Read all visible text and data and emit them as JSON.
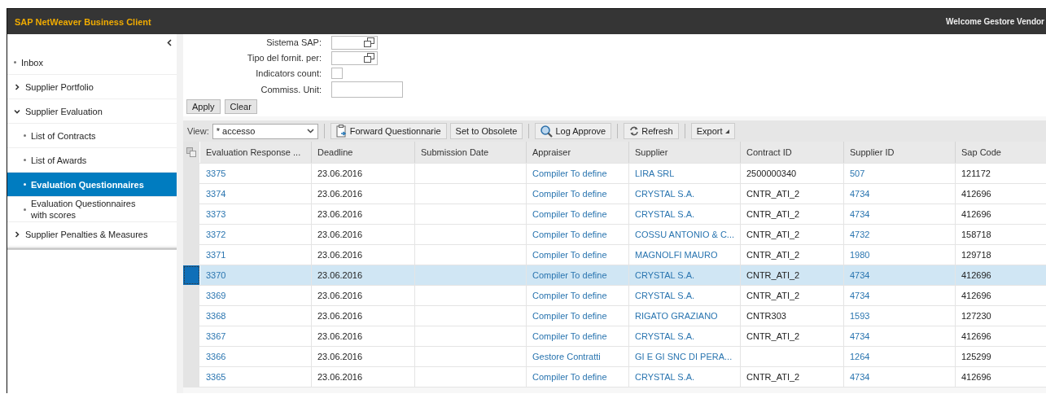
{
  "window": {
    "title": "SAP NetWeaver Business Client",
    "welcome": "Welcome Gestore Vendor"
  },
  "sidebar": {
    "items": [
      {
        "label": "Inbox",
        "kind": "leaf",
        "selected": false
      },
      {
        "label": "Supplier Portfolio",
        "kind": "group",
        "expanded": false
      },
      {
        "label": "Supplier Evaluation",
        "kind": "group",
        "expanded": true,
        "children": [
          {
            "label": "List of Contracts",
            "kind": "leaf",
            "selected": false
          },
          {
            "label": "List of Awards",
            "kind": "leaf",
            "selected": false
          },
          {
            "label": "Evaluation Questionnaires",
            "kind": "leaf",
            "selected": true
          },
          {
            "label": "Evaluation Questionnaires with scores",
            "kind": "leaf",
            "selected": false
          }
        ]
      },
      {
        "label": "Supplier Penalties & Measures",
        "kind": "group",
        "expanded": false
      }
    ]
  },
  "filter": {
    "fields": [
      {
        "label": "Sistema SAP:",
        "kind": "valuehelp"
      },
      {
        "label": "Tipo del fornit. per:",
        "kind": "valuehelp"
      },
      {
        "label": "Indicators count:",
        "kind": "checkbox",
        "checked": false
      },
      {
        "label": "Commiss. Unit:",
        "kind": "text"
      }
    ],
    "buttons": [
      "Apply",
      "Clear"
    ]
  },
  "toolbar": {
    "view_label": "View:",
    "view_value": "* accesso",
    "buttons": [
      {
        "label": "Forward Questionnarie",
        "kind": "forward"
      },
      {
        "label": "Set to Obsolete",
        "kind": "plain"
      },
      {
        "label": "Log Approve",
        "kind": "search"
      },
      {
        "label": "Refresh",
        "kind": "refresh"
      },
      {
        "label": "Export",
        "kind": "menu"
      }
    ]
  },
  "table": {
    "columns": [
      "Evaluation Response ...",
      "Deadline",
      "Submission Date",
      "Appraiser",
      "Supplier",
      "Contract ID",
      "Supplier ID",
      "Sap Code"
    ],
    "rows": [
      {
        "selected": false,
        "cells": [
          "3375",
          "23.06.2016",
          "",
          "Compiler To define",
          "LIRA SRL",
          "2500000340",
          "507",
          "121172"
        ]
      },
      {
        "selected": false,
        "cells": [
          "3374",
          "23.06.2016",
          "",
          "Compiler To define",
          "CRYSTAL S.A.",
          "CNTR_ATI_2",
          "4734",
          "412696"
        ]
      },
      {
        "selected": false,
        "cells": [
          "3373",
          "23.06.2016",
          "",
          "Compiler To define",
          "CRYSTAL S.A.",
          "CNTR_ATI_2",
          "4734",
          "412696"
        ]
      },
      {
        "selected": false,
        "cells": [
          "3372",
          "23.06.2016",
          "",
          "Compiler To define",
          "COSSU ANTONIO & C...",
          "CNTR_ATI_2",
          "4732",
          "158718"
        ]
      },
      {
        "selected": false,
        "cells": [
          "3371",
          "23.06.2016",
          "",
          "Compiler To define",
          "MAGNOLFI MAURO",
          "CNTR_ATI_2",
          "1980",
          "129718"
        ]
      },
      {
        "selected": true,
        "cells": [
          "3370",
          "23.06.2016",
          "",
          "Compiler To define",
          "CRYSTAL S.A.",
          "CNTR_ATI_2",
          "4734",
          "412696"
        ]
      },
      {
        "selected": false,
        "cells": [
          "3369",
          "23.06.2016",
          "",
          "Compiler To define",
          "CRYSTAL S.A.",
          "CNTR_ATI_2",
          "4734",
          "412696"
        ]
      },
      {
        "selected": false,
        "cells": [
          "3368",
          "23.06.2016",
          "",
          "Compiler To define",
          "RIGATO GRAZIANO",
          "CNTR303",
          "1593",
          "127230"
        ]
      },
      {
        "selected": false,
        "cells": [
          "3367",
          "23.06.2016",
          "",
          "Compiler To define",
          "CRYSTAL S.A.",
          "CNTR_ATI_2",
          "4734",
          "412696"
        ]
      },
      {
        "selected": false,
        "cells": [
          "3366",
          "23.06.2016",
          "",
          "Gestore Contratti",
          "GI E GI SNC DI PERA...",
          "",
          "1264",
          "125299"
        ]
      },
      {
        "selected": false,
        "cells": [
          "3365",
          "23.06.2016",
          "",
          "Compiler To define",
          "CRYSTAL S.A.",
          "CNTR_ATI_2",
          "4734",
          "412696"
        ]
      }
    ]
  }
}
